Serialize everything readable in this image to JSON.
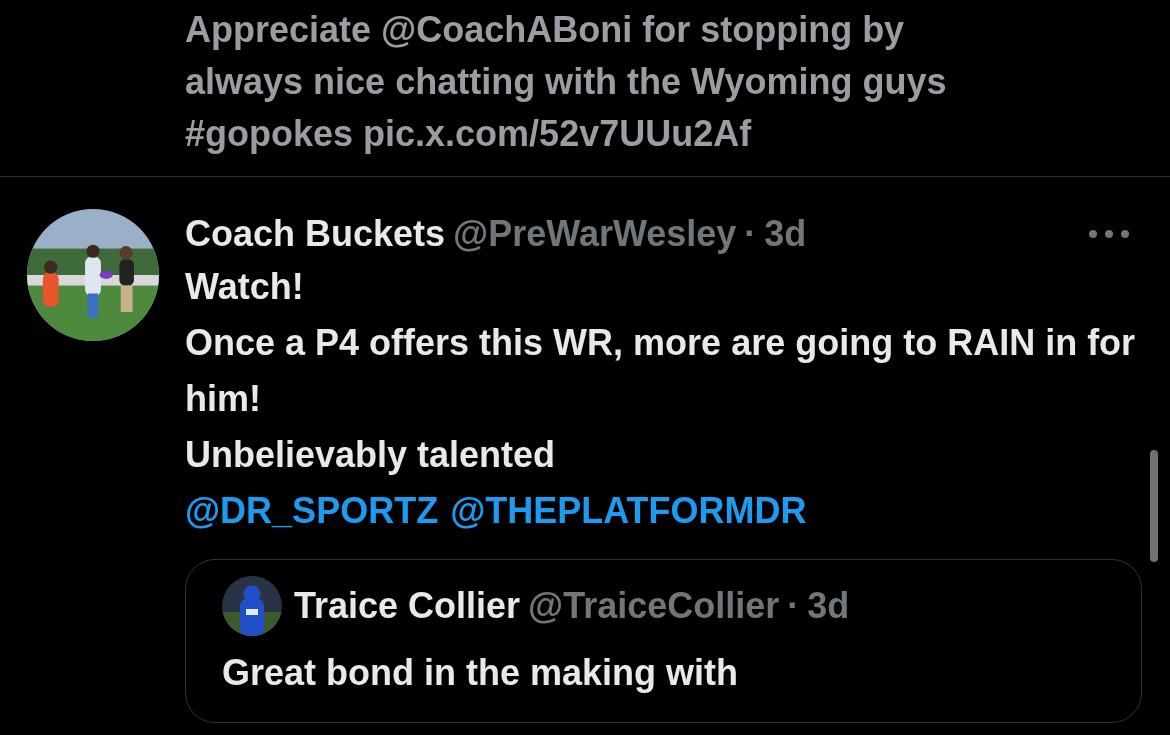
{
  "previous_post": {
    "lines": [
      "Appreciate @CoachABoni for stopping by",
      "always nice chatting with the Wyoming guys",
      "#gopokes pic.x.com/52v7UUu2Af"
    ]
  },
  "post": {
    "author": {
      "name": "Coach Buckets",
      "handle": "@PreWarWesley",
      "separator": "·",
      "time": "3d"
    },
    "paragraphs": [
      "Watch!",
      "Once a P4 offers this WR, more are going to RAIN in for him!",
      "Unbelievably talented"
    ],
    "mentions": [
      "@DR_SPORTZ",
      "@THEPLATFORMDR"
    ],
    "quoted_post": {
      "author": {
        "name": "Traice Collier",
        "handle": "@TraiceCollier",
        "separator": "·",
        "time": "3d"
      },
      "text": "Great bond in the making with"
    }
  }
}
